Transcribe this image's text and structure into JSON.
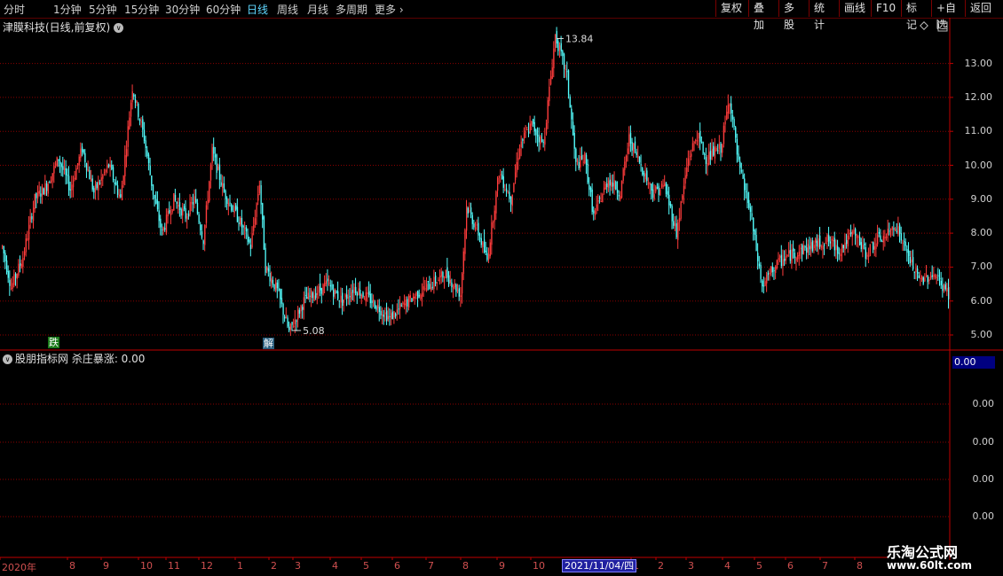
{
  "toolbar": {
    "periods": [
      "分时",
      "1分钟",
      "5分钟",
      "15分钟",
      "30分钟",
      "60分钟",
      "日线",
      "周线",
      "月线",
      "多周期",
      "更多"
    ],
    "active_period": "日线",
    "buttons": [
      "复权",
      "叠加",
      "多股",
      "统计",
      "画线",
      "F10",
      "标记",
      "+自选",
      "返回"
    ]
  },
  "main": {
    "title": "津膜科技(日线,前复权)",
    "high_label": "13.84",
    "low_label": "5.08",
    "marker_fall": "跌",
    "marker_solve": "解"
  },
  "sub": {
    "title": "股朋指标网  杀庄暴涨: 0.00",
    "current_value": "0.00",
    "ylabels": [
      "0.00",
      "0.00",
      "0.00",
      "0.00"
    ]
  },
  "xaxis": {
    "labels": [
      "2020年",
      "8",
      "9",
      "10",
      "11",
      "12",
      "1",
      "2",
      "3",
      "4",
      "5",
      "6",
      "7",
      "8",
      "9",
      "10",
      "1",
      "2",
      "3",
      "4",
      "5",
      "6",
      "7",
      "8"
    ],
    "cursor_date": "2021/11/04/四"
  },
  "watermark": {
    "title": "乐淘公式网",
    "url": "www.60lt.com"
  },
  "colors": {
    "up": "#ff3c3c",
    "down": "#54ffff",
    "grid": "#8b0000",
    "frame": "#c00000"
  },
  "chart_data": {
    "type": "candlestick",
    "title": "津膜科技(日线,前复权)",
    "ylim": [
      4.7,
      14.2
    ],
    "yticks": [
      5.0,
      6.0,
      7.0,
      8.0,
      9.0,
      10.0,
      11.0,
      12.0,
      13.0
    ],
    "price_path": [
      [
        7.6,
        0
      ],
      [
        6.4,
        6
      ],
      [
        7.3,
        14
      ],
      [
        9.0,
        22
      ],
      [
        9.4,
        30
      ],
      [
        10.2,
        38
      ],
      [
        9.3,
        46
      ],
      [
        10.5,
        54
      ],
      [
        9.2,
        62
      ],
      [
        10.0,
        72
      ],
      [
        9.0,
        80
      ],
      [
        12.3,
        88
      ],
      [
        10.8,
        96
      ],
      [
        9.2,
        102
      ],
      [
        8.0,
        108
      ],
      [
        9.0,
        116
      ],
      [
        8.5,
        124
      ],
      [
        9.0,
        130
      ],
      [
        7.8,
        136
      ],
      [
        10.4,
        142
      ],
      [
        9.2,
        150
      ],
      [
        8.4,
        160
      ],
      [
        7.6,
        168
      ],
      [
        9.5,
        174
      ],
      [
        7.0,
        178
      ],
      [
        6.3,
        186
      ],
      [
        5.08,
        194
      ],
      [
        6.0,
        204
      ],
      [
        6.5,
        220
      ],
      [
        6.0,
        230
      ],
      [
        6.4,
        238
      ],
      [
        6.0,
        250
      ],
      [
        5.5,
        262
      ],
      [
        6.2,
        280
      ],
      [
        6.8,
        300
      ],
      [
        6.2,
        310
      ],
      [
        8.8,
        314
      ],
      [
        8.0,
        322
      ],
      [
        7.2,
        328
      ],
      [
        9.8,
        336
      ],
      [
        9.0,
        344
      ],
      [
        10.6,
        350
      ],
      [
        11.2,
        358
      ],
      [
        10.6,
        366
      ],
      [
        13.84,
        374
      ],
      [
        12.6,
        382
      ],
      [
        10.0,
        388
      ],
      [
        10.2,
        394
      ],
      [
        8.5,
        400
      ],
      [
        9.6,
        410
      ],
      [
        9.2,
        418
      ],
      [
        10.8,
        424
      ],
      [
        10.0,
        432
      ],
      [
        9.2,
        440
      ],
      [
        9.4,
        448
      ],
      [
        8.0,
        456
      ],
      [
        10.2,
        464
      ],
      [
        10.9,
        470
      ],
      [
        10.2,
        476
      ],
      [
        10.5,
        486
      ],
      [
        12.0,
        492
      ],
      [
        10.0,
        498
      ],
      [
        8.6,
        506
      ],
      [
        6.4,
        514
      ],
      [
        7.0,
        522
      ],
      [
        7.3,
        530
      ],
      [
        7.6,
        546
      ],
      [
        7.8,
        558
      ],
      [
        7.5,
        566
      ],
      [
        8.0,
        576
      ],
      [
        7.4,
        584
      ],
      [
        7.8,
        592
      ],
      [
        7.9,
        598
      ],
      [
        8.3,
        604
      ],
      [
        7.4,
        612
      ],
      [
        6.6,
        620
      ],
      [
        6.8,
        630
      ],
      [
        6.2,
        640
      ]
    ],
    "index_range": [
      0,
      640
    ]
  }
}
